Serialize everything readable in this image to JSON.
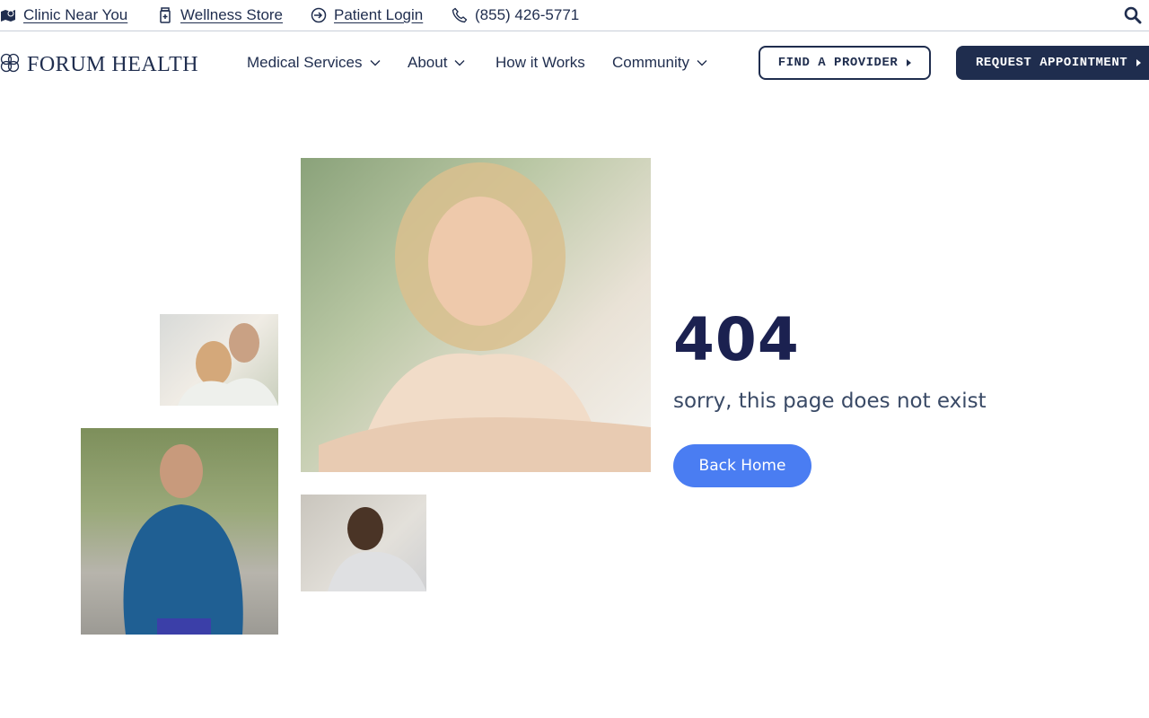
{
  "topbar": {
    "clinic": {
      "label": "Clinic Near You",
      "icon": "map-icon"
    },
    "store": {
      "label": "Wellness Store",
      "icon": "bottle-icon"
    },
    "login": {
      "label": "Patient Login",
      "icon": "login-icon"
    },
    "phone": {
      "label": "(855) 426-5771",
      "icon": "phone-icon"
    },
    "search_icon": "search-icon"
  },
  "header": {
    "logo_text": "FORUM HEALTH",
    "nav": [
      {
        "label": "Medical Services",
        "has_dropdown": true
      },
      {
        "label": "About",
        "has_dropdown": true
      },
      {
        "label": "How it Works",
        "has_dropdown": false
      },
      {
        "label": "Community",
        "has_dropdown": true
      }
    ],
    "find_provider": "FIND A PROVIDER",
    "request_appointment": "REQUEST APPOINTMENT"
  },
  "error": {
    "code": "404",
    "message": "sorry, this page does not exist",
    "back_label": "Back Home"
  },
  "colors": {
    "navy": "#1f2d4e",
    "heading": "#1b2150",
    "accent_blue": "#4a7df2"
  }
}
